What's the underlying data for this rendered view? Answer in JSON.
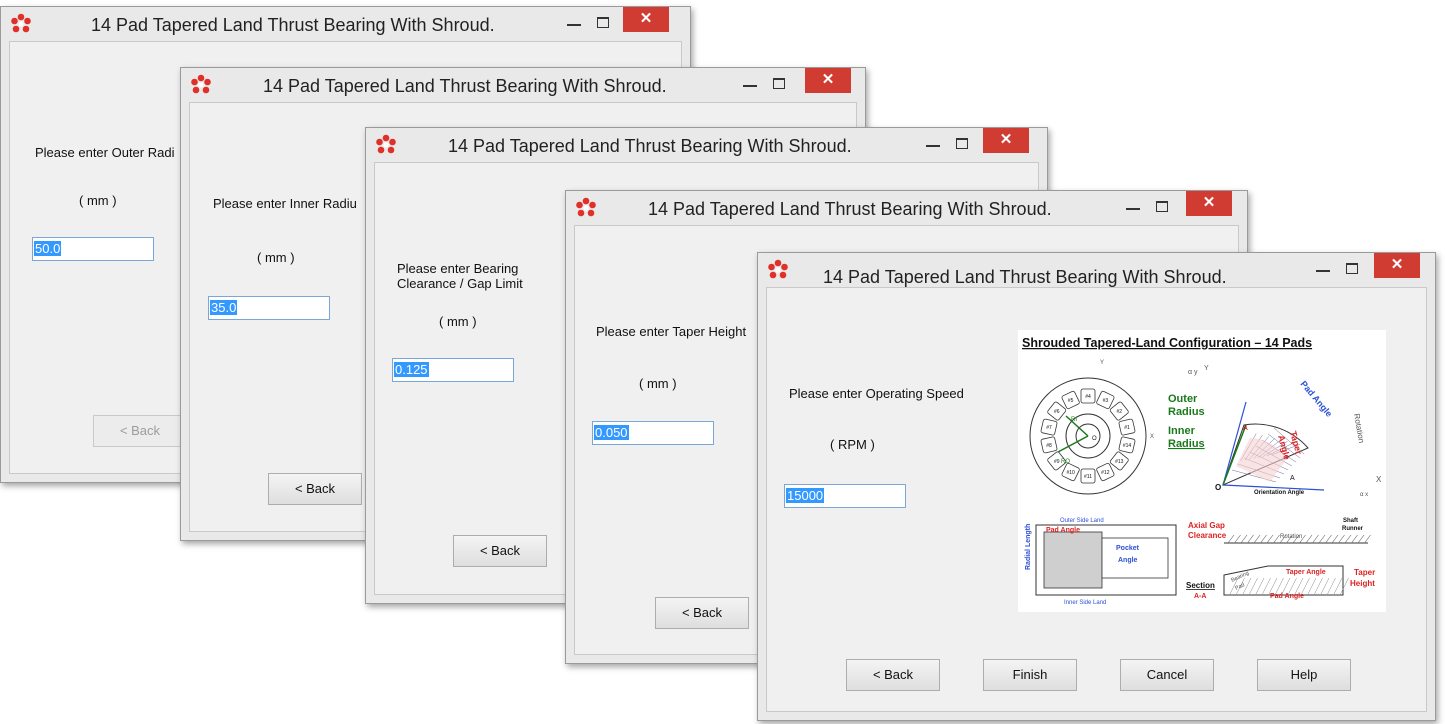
{
  "window_title": "14 Pad Tapered Land Thrust Bearing With Shroud.",
  "titlebar": {
    "minimize": "–",
    "maximize": "□",
    "close": "✕"
  },
  "dialogs": [
    {
      "prompt": "Please enter Outer Radi",
      "unit": "( mm )",
      "value": "50.0",
      "back": "< Back"
    },
    {
      "prompt": "Please enter Inner Radiu",
      "unit": "( mm )",
      "value": "35.0",
      "back": "< Back"
    },
    {
      "prompt_line1": "Please enter Bearing",
      "prompt_line2": "Clearance / Gap Limit",
      "unit": "( mm )",
      "value": "0.125",
      "back": "< Back"
    },
    {
      "prompt": "Please enter Taper Height",
      "unit": "( mm )",
      "value": "0.050",
      "back": "< Back"
    },
    {
      "prompt": "Please enter Operating Speed",
      "unit": "( RPM )",
      "value": "15000",
      "back": "< Back",
      "finish": "Finish",
      "cancel": "Cancel",
      "help": "Help"
    }
  ],
  "diagram": {
    "title": "Shrouded Tapered-Land Configuration – 14 Pads",
    "pad_labels": [
      "#1",
      "#2",
      "#3",
      "#4",
      "#5",
      "#6",
      "#7",
      "#8",
      "#9",
      "#10",
      "#11",
      "#12",
      "#13",
      "#14"
    ],
    "ri": "RI",
    "ro": "RO",
    "o": "O",
    "x": "X",
    "y": "Y",
    "a": "A",
    "alpha_y": "α y",
    "alpha_x": "α x",
    "outer": "Outer",
    "radius": "Radius",
    "inner": "Inner",
    "pad_angle": "Pad Angle",
    "taper": "Taper",
    "angle": "Angle",
    "rotation": "Rotation",
    "orientation_angle": "Orientation Angle",
    "outer_side_land": "Outer Side Land",
    "inner_side_land": "Inner Side Land",
    "radial_length": "Radial Length",
    "pocket": "Pocket",
    "section": "Section",
    "section_aa": "A-A",
    "axial_gap": "Axial Gap",
    "clearance": "Clearance",
    "shaft": "Shaft",
    "runner": "Runner",
    "bearing": "Bearing",
    "pad": "Pad",
    "taper_angle": "Taper Angle",
    "height": "Height"
  }
}
